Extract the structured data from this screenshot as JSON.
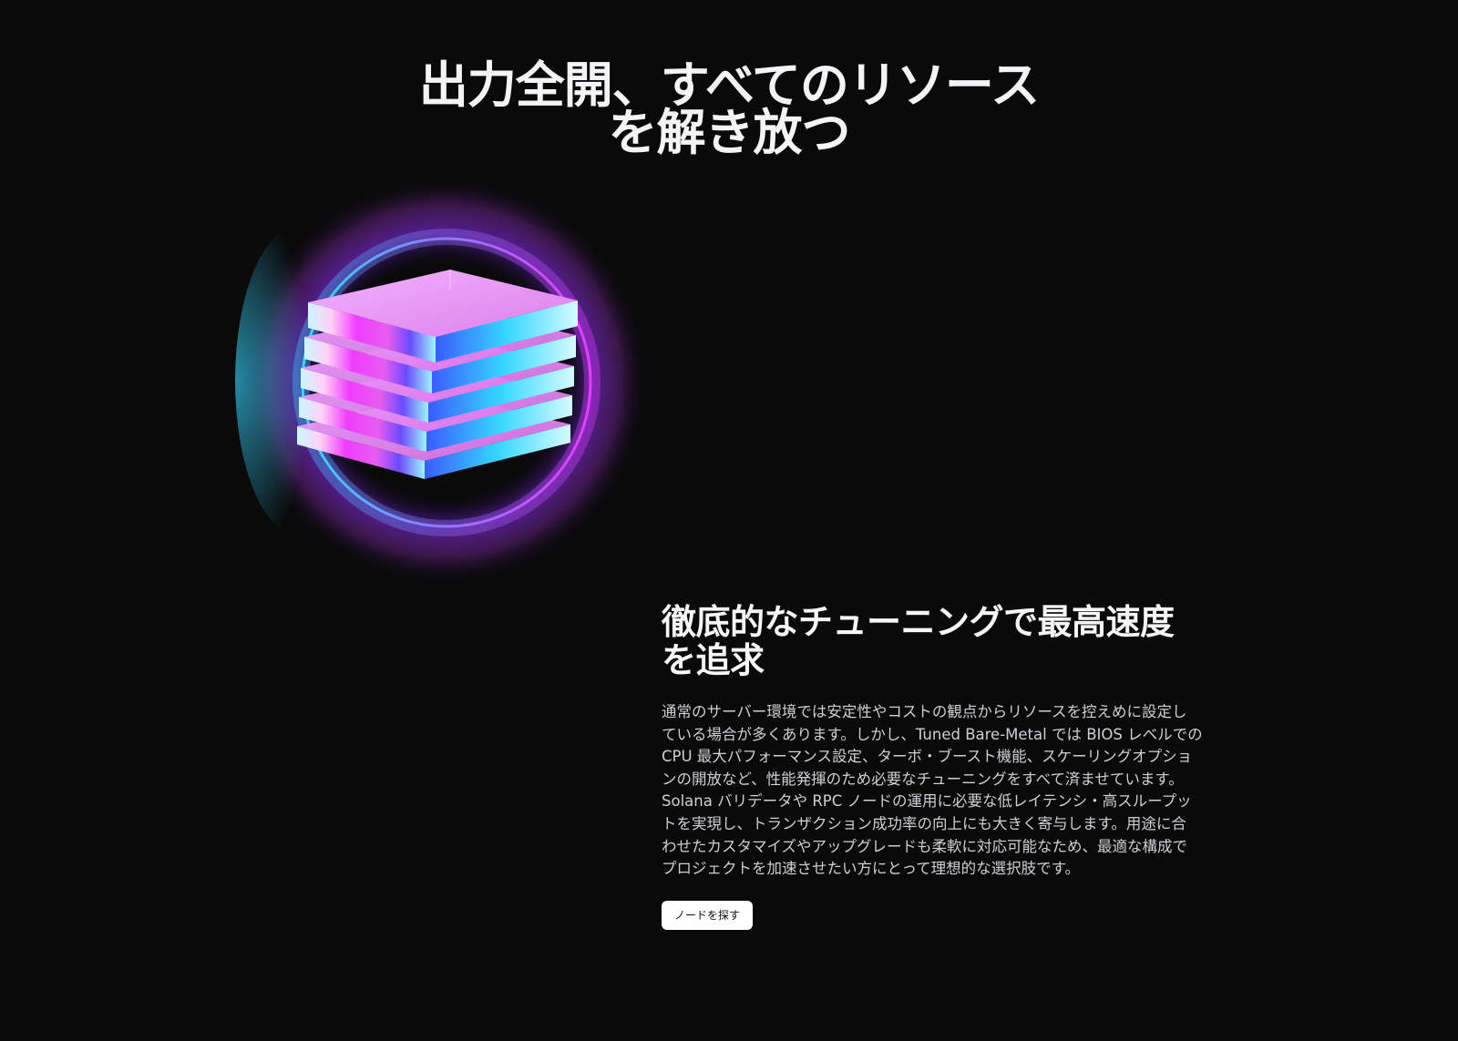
{
  "hero": {
    "title_line1": "出力全開、すべてのリソース",
    "title_line2": "を解き放つ"
  },
  "visual": {
    "icon": "stacked-layers-icon",
    "colors": {
      "cyan": "#35d7ff",
      "magenta": "#e63cff",
      "pink": "#ff7ad9",
      "blue": "#3b5cff"
    }
  },
  "feature": {
    "title_line1": "徹底的なチューニングで最高速度",
    "title_line2": "を追求",
    "body_lines": [
      "通常のサーバー環境では安定性やコストの観点からリソースを控えめに設定し",
      "ている場合が多くあります。しかし、Tuned Bare-Metal では BIOS レベルでの",
      "CPU 最大パフォーマンス設定、ターボ・ブースト機能、スケーリングオプショ",
      "ンの開放など、性能発揮のため必要なチューニングをすべて済ませています。",
      "Solana バリデータや RPC ノードの運用に必要な低レイテンシ・高スループッ",
      "トを実現し、トランザクション成功率の向上にも大きく寄与します。用途に合",
      "わせたカスタマイズやアップグレードも柔軟に対応可能なため、最適な構成で",
      "プロジェクトを加速させたい方にとって理想的な選択肢です。"
    ],
    "cta_label": "ノードを探す"
  }
}
